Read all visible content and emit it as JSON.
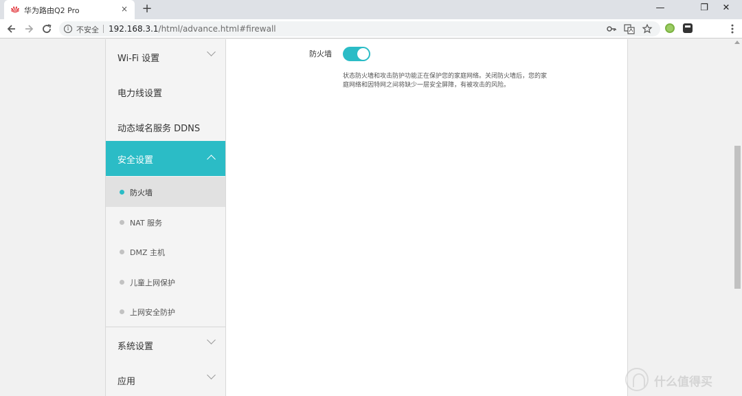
{
  "browser": {
    "tab_title": "华为路由Q2 Pro",
    "tab_close": "×",
    "new_tab": "+",
    "security_label": "不安全",
    "url_host": "192.168.3.1",
    "url_path": "/html/advance.html#firewall",
    "window_controls": {
      "minimize": "—",
      "maximize": "❐",
      "close": "✕"
    },
    "icons": [
      "huawei-logo-icon",
      "back-icon",
      "forward-icon",
      "reload-icon",
      "info-icon",
      "key-icon",
      "translate-icon",
      "star-icon",
      "extension-icon",
      "menu-icon"
    ]
  },
  "sidebar": {
    "items": [
      {
        "label": "Wi-Fi 设置"
      },
      {
        "label": "电力线设置"
      },
      {
        "label": "动态域名服务 DDNS"
      },
      {
        "label": "安全设置"
      },
      {
        "label": "系统设置"
      },
      {
        "label": "应用"
      }
    ],
    "security_subitems": [
      {
        "label": "防火墙"
      },
      {
        "label": "NAT 服务"
      },
      {
        "label": "DMZ 主机"
      },
      {
        "label": "儿童上网保护"
      },
      {
        "label": "上网安全防护"
      }
    ]
  },
  "content": {
    "firewall_label": "防火墙",
    "firewall_enabled": true,
    "firewall_description": "状态防火墙和攻击防护功能正在保护您的家庭网络。关闭防火墙后，您的家庭网络和因特网之间将缺少一层安全屏障，有被攻击的风险。"
  },
  "watermark": {
    "text": "什么值得买"
  },
  "colors": {
    "accent": "#2bbcc6",
    "sidebar_bg": "#f4f4f4",
    "page_bg": "#f1f1f1"
  }
}
